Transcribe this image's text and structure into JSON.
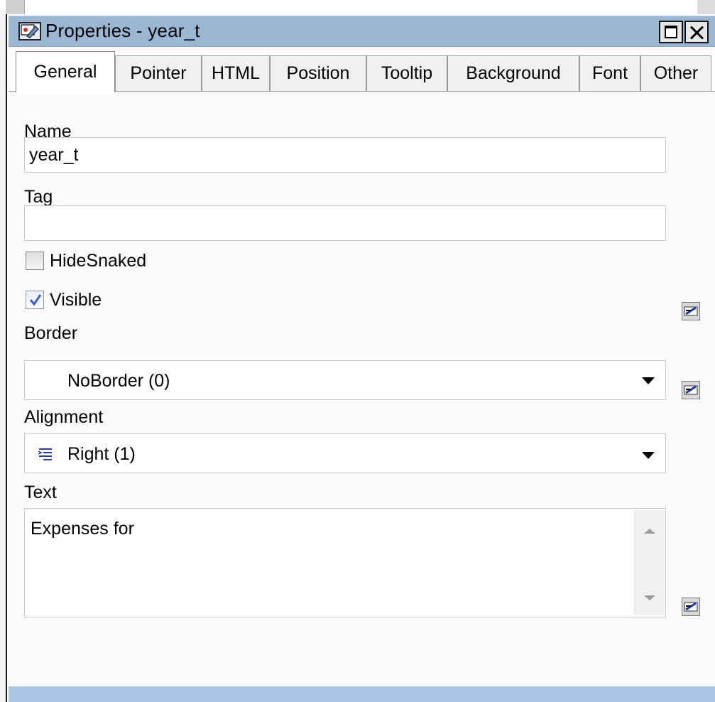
{
  "window": {
    "title": "Properties -  year_t",
    "icon": "properties-icon"
  },
  "tabs": [
    {
      "label": "General",
      "active": true
    },
    {
      "label": "Pointer"
    },
    {
      "label": "HTML"
    },
    {
      "label": "Position"
    },
    {
      "label": "Tooltip"
    },
    {
      "label": "Background"
    },
    {
      "label": "Font"
    },
    {
      "label": "Other"
    }
  ],
  "general": {
    "name_label": "Name",
    "name_value": "year_t",
    "tag_label": "Tag",
    "tag_value": "",
    "hidesnaked_label": "HideSnaked",
    "hidesnaked_checked": false,
    "visible_label": "Visible",
    "visible_checked": true,
    "border_label": "Border",
    "border_value": "NoBorder (0)",
    "alignment_label": "Alignment",
    "alignment_value": "Right (1)",
    "alignment_icon": "align-right-icon",
    "text_label": "Text",
    "text_value": "Expenses for"
  },
  "colors": {
    "titlebar": "#9bb7d3",
    "accent": "#3a5fcd"
  }
}
